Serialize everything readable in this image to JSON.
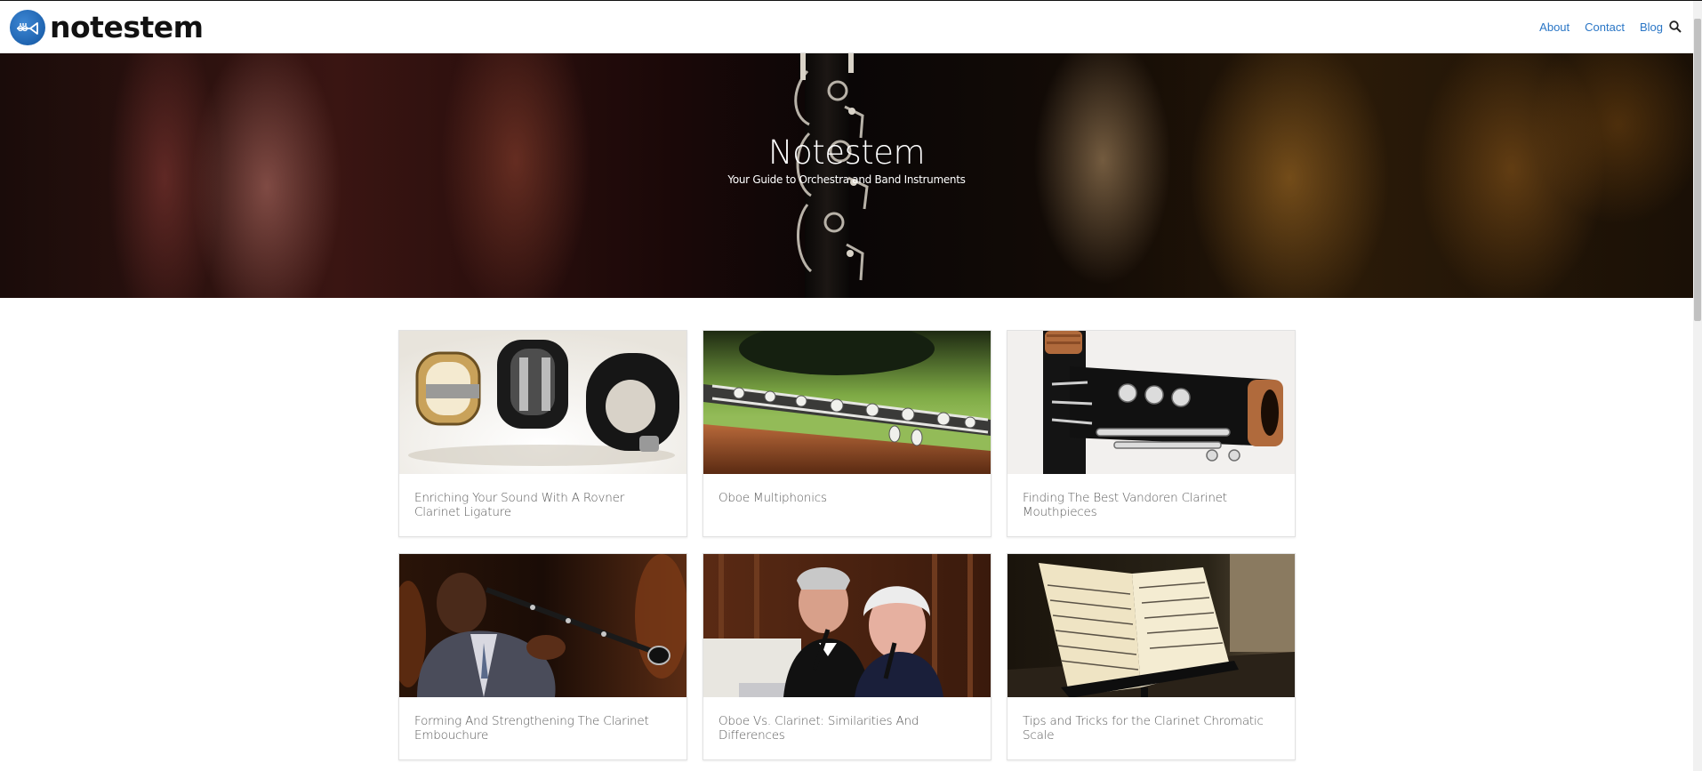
{
  "header": {
    "logo_text": "notestem",
    "nav": [
      {
        "label": "About"
      },
      {
        "label": "Contact"
      },
      {
        "label": "Blog"
      }
    ],
    "search_icon": "search-icon",
    "link_color": "#2a76c6",
    "logo_color": "#1f64b0"
  },
  "hero": {
    "title": "Notestem",
    "subtitle": "Your Guide to Orchestra and Band Instruments"
  },
  "posts": [
    {
      "title": "Enriching Your Sound With A Rovner Clarinet Ligature"
    },
    {
      "title": "Oboe Multiphonics"
    },
    {
      "title": "Finding The Best Vandoren Clarinet Mouthpieces"
    },
    {
      "title": "Forming And Strengthening The Clarinet Embouchure"
    },
    {
      "title": "Oboe Vs. Clarinet: Similarities And Differences"
    },
    {
      "title": "Tips and Tricks for the Clarinet Chromatic Scale"
    }
  ]
}
